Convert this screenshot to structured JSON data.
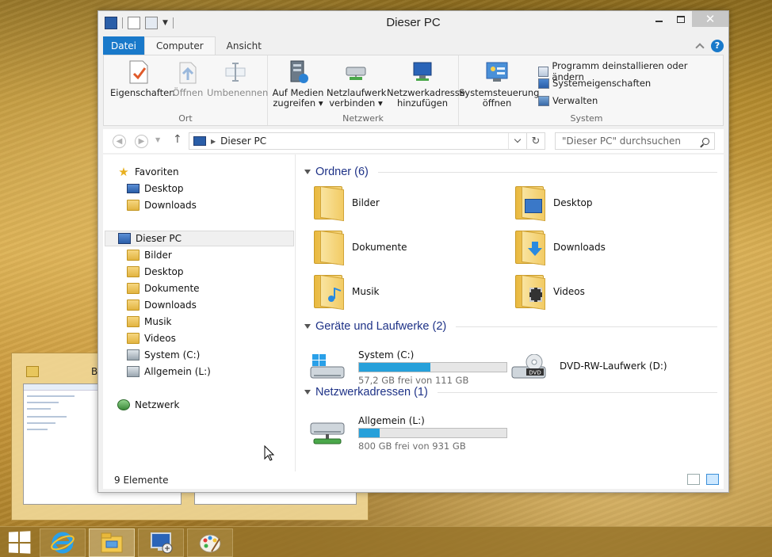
{
  "window": {
    "title": "Dieser PC"
  },
  "ribbon": {
    "tabs": [
      {
        "label": "Datei"
      },
      {
        "label": "Computer"
      },
      {
        "label": "Ansicht"
      }
    ],
    "groups": {
      "ort": {
        "label": "Ort",
        "buttons": [
          {
            "label": "Eigenschaften"
          },
          {
            "label": "Öffnen"
          },
          {
            "label": "Umbenennen"
          }
        ]
      },
      "netzwerk": {
        "label": "Netzwerk",
        "buttons": [
          {
            "line1": "Auf Medien",
            "line2": "zugreifen"
          },
          {
            "line1": "Netzlaufwerk",
            "line2": "verbinden"
          },
          {
            "line1": "Netzwerkadresse",
            "line2": "hinzufügen"
          }
        ]
      },
      "system": {
        "label": "System",
        "systemsteuerung": {
          "line1": "Systemsteuerung",
          "line2": "öffnen"
        },
        "items": [
          {
            "label": "Programm deinstallieren oder ändern"
          },
          {
            "label": "Systemeigenschaften"
          },
          {
            "label": "Verwalten"
          }
        ]
      }
    }
  },
  "addressbar": {
    "path": "Dieser PC",
    "search_placeholder": "\"Dieser PC\" durchsuchen"
  },
  "navpane": {
    "favorites_label": "Favoriten",
    "favorites": [
      {
        "label": "Desktop"
      },
      {
        "label": "Downloads"
      }
    ],
    "thispc_label": "Dieser PC",
    "thispc_items": [
      {
        "label": "Bilder"
      },
      {
        "label": "Desktop"
      },
      {
        "label": "Dokumente"
      },
      {
        "label": "Downloads"
      },
      {
        "label": "Musik"
      },
      {
        "label": "Videos"
      },
      {
        "label": "System (C:)"
      },
      {
        "label": "Allgemein (L:)"
      }
    ],
    "network_label": "Netzwerk"
  },
  "main": {
    "folders_heading": "Ordner (6)",
    "folders": [
      {
        "label": "Bilder"
      },
      {
        "label": "Desktop"
      },
      {
        "label": "Dokumente"
      },
      {
        "label": "Downloads"
      },
      {
        "label": "Musik"
      },
      {
        "label": "Videos"
      }
    ],
    "devices_heading": "Geräte und Laufwerke (2)",
    "drive_c": {
      "name": "System (C:)",
      "free": "57,2 GB frei von 111 GB",
      "used_fraction": 0.485
    },
    "drive_d": {
      "name": "DVD-RW-Laufwerk (D:)"
    },
    "network_heading": "Netzwerkadressen (1)",
    "drive_l": {
      "name": "Allgemein (L:)",
      "free": "800 GB frei von 931 GB",
      "used_fraction": 0.14
    }
  },
  "status": {
    "count": "9 Elemente"
  },
  "switcher": {
    "label": "B"
  },
  "colors": {
    "accent": "#1979ca",
    "group_heading": "#1e3287",
    "drive_fill": "#26a0da"
  }
}
